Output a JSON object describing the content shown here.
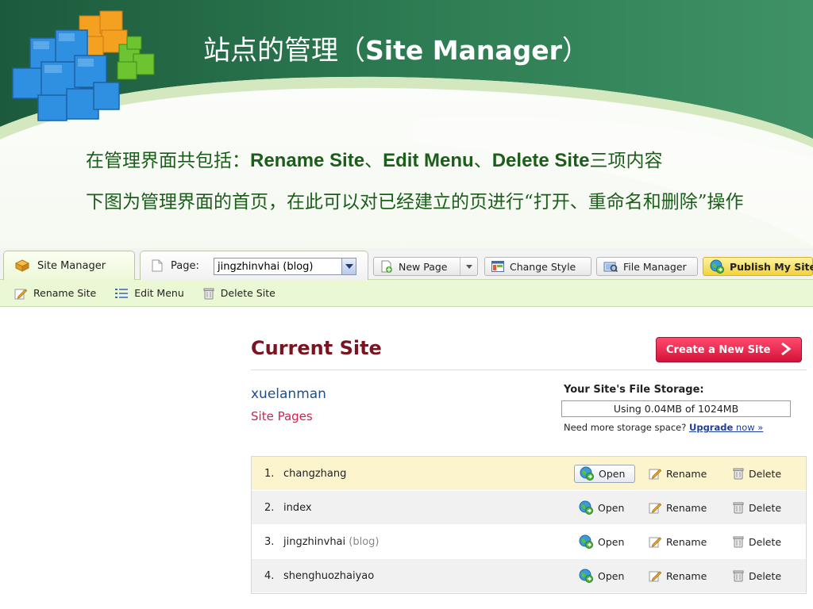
{
  "slide": {
    "title_zh": "站点的管理（",
    "title_en": "Site Manager",
    "title_close": "）",
    "para1_pre": "在管理界面共包括：",
    "para1_item1": "Rename Site",
    "para1_sep1": "、",
    "para1_item2": "Edit Menu",
    "para1_sep2": "、",
    "para1_item3": "Delete Site",
    "para1_post": "三项内容",
    "para2": "下图为管理界面的首页，在此可以对已经建立的页进行“打开、重命名和删除”操作"
  },
  "tabs": {
    "site_manager": "Site Manager",
    "page_label": "Page:",
    "page_selected": "jingzhinvhai (blog)"
  },
  "toolbar": {
    "new_page": "New Page",
    "change_style": "Change Style",
    "file_manager": "File Manager",
    "publish": "Publish My Site"
  },
  "subbar": {
    "rename_site": "Rename Site",
    "edit_menu": "Edit Menu",
    "delete_site": "Delete Site"
  },
  "main": {
    "current_site_title": "Current Site",
    "create_button": "Create a New Site",
    "site_name": "xuelanman",
    "site_pages": "Site Pages",
    "storage_label": "Your Site's File Storage:",
    "storage_usage": "Using 0.04MB of 1024MB",
    "storage_more": "Need more storage space?",
    "upgrade_bold": "Upgrade",
    "upgrade_rest": " now »"
  },
  "actions": {
    "open": "Open",
    "rename": "Rename",
    "delete": "Delete"
  },
  "pages": [
    {
      "num": "1.",
      "name": "changzhang",
      "tag": ""
    },
    {
      "num": "2.",
      "name": "index",
      "tag": ""
    },
    {
      "num": "3.",
      "name": "jingzhinvhai",
      "tag": "(blog)"
    },
    {
      "num": "4.",
      "name": "shenghuozhaiyao",
      "tag": ""
    }
  ],
  "colors": {
    "slide_green": "#1f6b45",
    "text_green": "#1a5e1a",
    "accent_red": "#7a1420",
    "create_red": "#e0193f",
    "publish_yellow": "#f2d23a"
  }
}
